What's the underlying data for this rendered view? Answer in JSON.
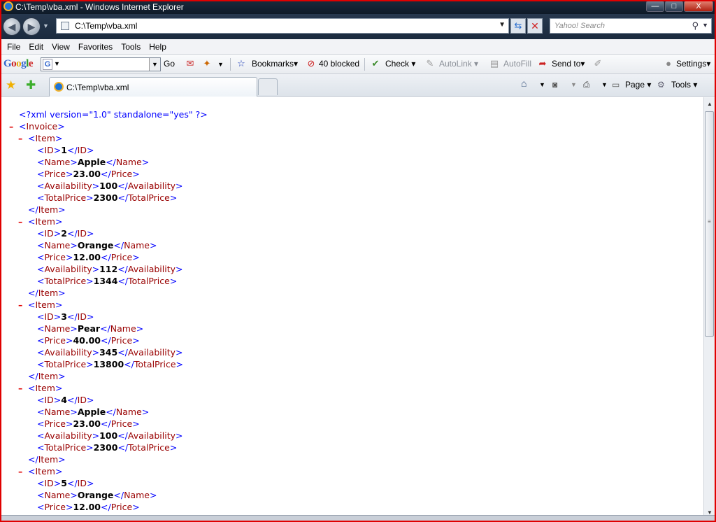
{
  "window": {
    "title": "C:\\Temp\\vba.xml - Windows Internet Explorer",
    "min_label": "—",
    "max_label": "□",
    "close_label": "X"
  },
  "address": {
    "url": "C:\\Temp\\vba.xml",
    "search_placeholder": "Yahoo! Search"
  },
  "menu": [
    "File",
    "Edit",
    "View",
    "Favorites",
    "Tools",
    "Help"
  ],
  "google_toolbar": {
    "logo": "Google",
    "go_label": "Go",
    "bookmarks_label": "Bookmarks",
    "blocked_label": "40 blocked",
    "check_label": "Check",
    "autolink_label": "AutoLink",
    "autofill_label": "AutoFill",
    "sendto_label": "Send to",
    "settings_label": "Settings"
  },
  "tabs": {
    "active_tab_label": "C:\\Temp\\vba.xml",
    "page_label": "Page",
    "tools_label": "Tools"
  },
  "xml": {
    "declaration": "<?xml version=\"1.0\" standalone=\"yes\" ?>",
    "root_open": "Invoice",
    "items": [
      {
        "ID": "1",
        "Name": "Apple",
        "Price": "23.00",
        "Availability": "100",
        "TotalPrice": "2300"
      },
      {
        "ID": "2",
        "Name": "Orange",
        "Price": "12.00",
        "Availability": "112",
        "TotalPrice": "1344"
      },
      {
        "ID": "3",
        "Name": "Pear",
        "Price": "40.00",
        "Availability": "345",
        "TotalPrice": "13800"
      },
      {
        "ID": "4",
        "Name": "Apple",
        "Price": "23.00",
        "Availability": "100",
        "TotalPrice": "2300"
      },
      {
        "ID": "5",
        "Name": "Orange",
        "Price": "12.00"
      }
    ]
  },
  "colors": {
    "tag": "#990000",
    "bracket": "#0000ff",
    "collapse_minus": "#e00000",
    "frame": "#e00000"
  }
}
